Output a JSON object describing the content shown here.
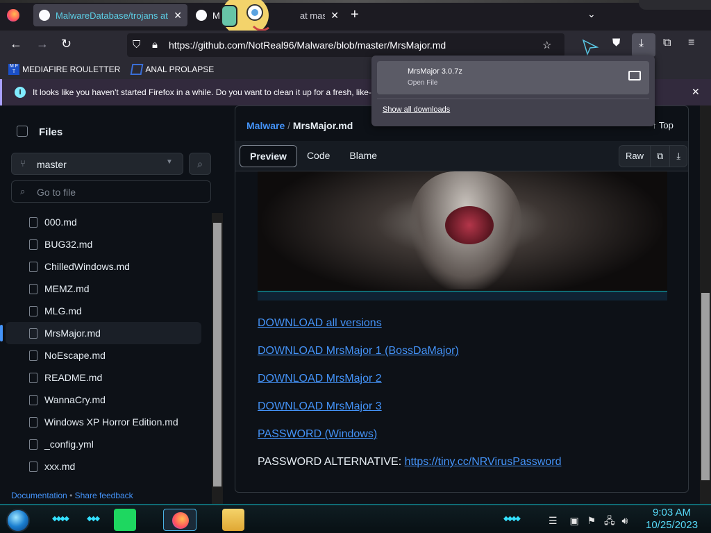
{
  "browser": {
    "tabs": [
      {
        "title": "MalwareDatabase/trojans at m",
        "close": "✕"
      },
      {
        "title": "M",
        "title_tail": "at mast",
        "close": "✕"
      }
    ],
    "new_tab": "+",
    "tab_list": "⌄",
    "url": "https://github.com/NotReal96/Malware/blob/master/MrsMajor.md",
    "bookmarks": [
      {
        "label": "MEDIAFIRE ROULETTER",
        "icon": "mediafire-icon"
      },
      {
        "label": "ANAL PROLAPSE",
        "icon": "bookmark-icon"
      }
    ],
    "notification": "It looks like you haven't started Firefox in a while. Do you want to clean it up for a fresh, like-n"
  },
  "downloads": {
    "item_name": "MrsMajor 3.0.7z",
    "item_status": "Open File",
    "show_all": "Show all downloads"
  },
  "sidebar": {
    "title": "Files",
    "branch": "master",
    "goto_placeholder": "Go to file",
    "files": [
      "000.md",
      "BUG32.md",
      "ChilledWindows.md",
      "MEMZ.md",
      "MLG.md",
      "MrsMajor.md",
      "NoEscape.md",
      "README.md",
      "WannaCry.md",
      "Windows XP Horror Edition.md",
      "_config.yml",
      "xxx.md"
    ],
    "selected_file": "MrsMajor.md",
    "footer_docs": "Documentation",
    "footer_sep": "•",
    "footer_feedback": "Share feedback"
  },
  "content": {
    "repo": "Malware",
    "sep": "/",
    "file": "MrsMajor.md",
    "top": "Top",
    "tabs": {
      "preview": "Preview",
      "code": "Code",
      "blame": "Blame"
    },
    "raw": "Raw",
    "links": [
      "DOWNLOAD all versions",
      "DOWNLOAD MrsMajor 1 (BossDaMajor)",
      "DOWNLOAD MrsMajor 2",
      "DOWNLOAD MrsMajor 3",
      "PASSWORD (Windows)"
    ],
    "password_alt_label": "PASSWORD ALTERNATIVE:",
    "password_alt_url": "https://tiny.cc/NRVirusPassword"
  },
  "taskbar": {
    "time": "9:03 AM",
    "date": "10/25/2023"
  },
  "colors": {
    "link": "#4493f8",
    "accent": "#5ccfe6",
    "taskbar_accent": "#34e0ff"
  }
}
